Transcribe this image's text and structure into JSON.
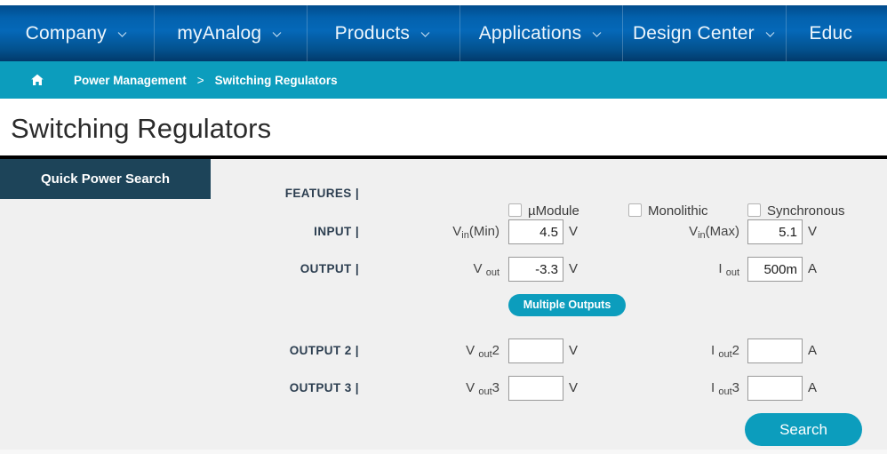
{
  "nav": {
    "items": [
      {
        "label": "Company",
        "caret": "chevron-down-icon"
      },
      {
        "label": "myAnalog",
        "caret": "chevron-down-icon"
      },
      {
        "label": "Products",
        "caret": "chevron-down-icon"
      },
      {
        "label": "Applications",
        "caret": "chevron-down-icon"
      },
      {
        "label": "Design Center",
        "caret": "chevron-down-icon"
      },
      {
        "label": "Educ",
        "caret": ""
      }
    ]
  },
  "breadcrumb": {
    "home_icon": "home-icon",
    "items": [
      "Power Management",
      "Switching Regulators"
    ],
    "separator": ">"
  },
  "page": {
    "title": "Switching Regulators"
  },
  "tab": {
    "label": "Quick Power Search"
  },
  "form": {
    "rows": {
      "features": "FEATURES |",
      "input": "INPUT |",
      "output": "OUTPUT |",
      "output2": "OUTPUT 2 |",
      "output3": "OUTPUT 3 |"
    },
    "checkboxes": [
      {
        "label": "µModule",
        "checked": false
      },
      {
        "label": "Monolithic",
        "checked": false
      },
      {
        "label": "Synchronous",
        "checked": false
      }
    ],
    "fields": {
      "vin_min": {
        "label_main": "V",
        "label_sub": "in",
        "label_tail": "(Min)",
        "value": "4.5",
        "unit": "V",
        "placeholder": ""
      },
      "vin_max": {
        "label_main": "V",
        "label_sub": "in",
        "label_tail": "(Max)",
        "value": "5.1",
        "unit": "V",
        "placeholder": ""
      },
      "vout": {
        "label_main": "V",
        "label_sub": "out",
        "label_tail": "",
        "value": "-3.3",
        "unit": "V",
        "placeholder": ""
      },
      "iout": {
        "label_main": "I",
        "label_sub": "out",
        "label_tail": "",
        "value": "500m",
        "unit": "A",
        "placeholder": ""
      },
      "vout2": {
        "label_main": "V",
        "label_sub": "out",
        "label_tail": "2",
        "value": "",
        "unit": "V",
        "placeholder": ""
      },
      "iout2": {
        "label_main": "I",
        "label_sub": "out",
        "label_tail": "2",
        "value": "",
        "unit": "A",
        "placeholder": ""
      },
      "vout3": {
        "label_main": "V",
        "label_sub": "out",
        "label_tail": "3",
        "value": "",
        "unit": "V",
        "placeholder": ""
      },
      "iout3": {
        "label_main": "I",
        "label_sub": "out",
        "label_tail": "3",
        "value": "",
        "unit": "A",
        "placeholder": ""
      }
    },
    "buttons": {
      "multiple_outputs": "Multiple Outputs",
      "search": "Search"
    }
  },
  "colors": {
    "nav_blue": "#0361ad",
    "crumb_teal": "#0c9dbd",
    "tab_navy": "#1d4459",
    "panel_gray": "#f0f0f0",
    "accent_teal": "#0c9dbd"
  }
}
